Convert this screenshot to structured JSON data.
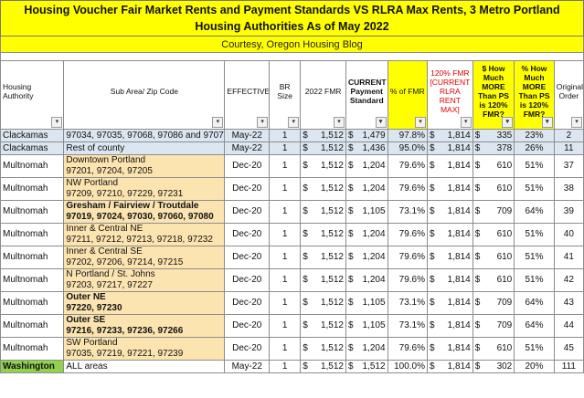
{
  "title": "Housing Voucher Fair Market Rents and Payment Standards VS RLRA Max Rents, 3 Metro Portland Housing Authorities As of May 2022",
  "courtesy": "Courtesy, Oregon Housing Blog",
  "headers": {
    "authority": "Housing Authority",
    "subarea": "Sub Area/ Zip Code",
    "effective": "EFFECTIVE",
    "br_size": "BR Size",
    "fmr2022": "2022 FMR",
    "current_ps": "CURRENT Payment Standard",
    "pct_fmr": "% of FMR",
    "fmr120": "120% FMR [CURRENT RLRA RENT MAX]",
    "how_much": "$ How Much MORE Than PS is 120% FMR?",
    "pct_more": "% How Much MORE Than PS is 120% FMR?",
    "orig_order": "Original Order"
  },
  "filter_glyph": "▾",
  "filter_glyph_active": "▾",
  "currency": "$",
  "rows": [
    {
      "authority": "Clackamas",
      "sub1": "97034, 97035, 97068, 97086 and 9707",
      "sub2": "",
      "effective": "May-22",
      "br": "1",
      "fmr": "1,512",
      "ps": "1,479",
      "pct": "97.8%",
      "fmr120": "1,814",
      "more": "335",
      "pctmore": "23%",
      "orig": "2",
      "style": "blue",
      "bold": false
    },
    {
      "authority": "Clackamas",
      "sub1": "Rest of county",
      "sub2": "",
      "effective": "May-22",
      "br": "1",
      "fmr": "1,512",
      "ps": "1,436",
      "pct": "95.0%",
      "fmr120": "1,814",
      "more": "378",
      "pctmore": "26%",
      "orig": "11",
      "style": "blue",
      "bold": false
    },
    {
      "authority": "Multnomah",
      "sub1": "Downtown Portland",
      "sub2": "97201, 97204, 97205",
      "effective": "Dec-20",
      "br": "1",
      "fmr": "1,512",
      "ps": "1,204",
      "pct": "79.6%",
      "fmr120": "1,814",
      "more": "610",
      "pctmore": "51%",
      "orig": "37",
      "style": "tan",
      "bold": false
    },
    {
      "authority": "Multnomah",
      "sub1": "NW Portland",
      "sub2": "97209, 97210, 97229, 97231",
      "effective": "Dec-20",
      "br": "1",
      "fmr": "1,512",
      "ps": "1,204",
      "pct": "79.6%",
      "fmr120": "1,814",
      "more": "610",
      "pctmore": "51%",
      "orig": "38",
      "style": "tan",
      "bold": false
    },
    {
      "authority": "Multnomah",
      "sub1": "Gresham / Fairview / Troutdale",
      "sub2": "97019, 97024, 97030, 97060, 97080",
      "effective": "Dec-20",
      "br": "1",
      "fmr": "1,512",
      "ps": "1,105",
      "pct": "73.1%",
      "fmr120": "1,814",
      "more": "709",
      "pctmore": "64%",
      "orig": "39",
      "style": "tan",
      "bold": true
    },
    {
      "authority": "Multnomah",
      "sub1": "Inner & Central NE",
      "sub2": "97211, 97212, 97213, 97218, 97232",
      "effective": "Dec-20",
      "br": "1",
      "fmr": "1,512",
      "ps": "1,204",
      "pct": "79.6%",
      "fmr120": "1,814",
      "more": "610",
      "pctmore": "51%",
      "orig": "40",
      "style": "tan",
      "bold": false
    },
    {
      "authority": "Multnomah",
      "sub1": "Inner & Central SE",
      "sub2": "97202, 97206, 97214, 97215",
      "effective": "Dec-20",
      "br": "1",
      "fmr": "1,512",
      "ps": "1,204",
      "pct": "79.6%",
      "fmr120": "1,814",
      "more": "610",
      "pctmore": "51%",
      "orig": "41",
      "style": "tan",
      "bold": false
    },
    {
      "authority": "Multnomah",
      "sub1": "N Portland / St. Johns",
      "sub2": "97203, 97217, 97227",
      "effective": "Dec-20",
      "br": "1",
      "fmr": "1,512",
      "ps": "1,204",
      "pct": "79.6%",
      "fmr120": "1,814",
      "more": "610",
      "pctmore": "51%",
      "orig": "42",
      "style": "tan",
      "bold": false
    },
    {
      "authority": "Multnomah",
      "sub1": "Outer NE",
      "sub2": "97220, 97230",
      "effective": "Dec-20",
      "br": "1",
      "fmr": "1,512",
      "ps": "1,105",
      "pct": "73.1%",
      "fmr120": "1,814",
      "more": "709",
      "pctmore": "64%",
      "orig": "43",
      "style": "tan",
      "bold": true
    },
    {
      "authority": "Multnomah",
      "sub1": "Outer SE",
      "sub2": "97216, 97233, 97236, 97266",
      "effective": "Dec-20",
      "br": "1",
      "fmr": "1,512",
      "ps": "1,105",
      "pct": "73.1%",
      "fmr120": "1,814",
      "more": "709",
      "pctmore": "64%",
      "orig": "44",
      "style": "tan",
      "bold": true
    },
    {
      "authority": "Multnomah",
      "sub1": "SW Portland",
      "sub2": "97035, 97219, 97221, 97239",
      "effective": "Dec-20",
      "br": "1",
      "fmr": "1,512",
      "ps": "1,204",
      "pct": "79.6%",
      "fmr120": "1,814",
      "more": "610",
      "pctmore": "51%",
      "orig": "45",
      "style": "tan",
      "bold": false
    },
    {
      "authority": "Washington",
      "sub1": "ALL areas",
      "sub2": "",
      "effective": "May-22",
      "br": "1",
      "fmr": "1,512",
      "ps": "1,512",
      "pct": "100.0%",
      "fmr120": "1,814",
      "more": "302",
      "pctmore": "20%",
      "orig": "111",
      "style": "green",
      "bold": false
    }
  ]
}
